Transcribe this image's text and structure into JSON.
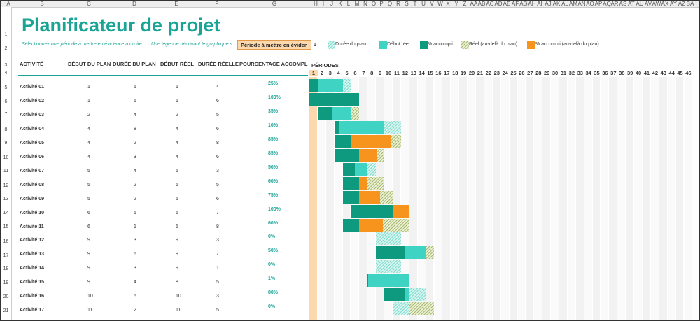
{
  "title": "Planificateur de projet",
  "subtitle_left": "Sélectionnez une période à mettre en évidence à droite",
  "subtitle_mid": "Une légende décrivant le graphique s",
  "period_highlight": {
    "label": "Période à mettre en éviden",
    "value": "1"
  },
  "legend": [
    {
      "label": "Durée du plan",
      "type": "hatch-plan"
    },
    {
      "label": "Début réel",
      "type": "solid-real"
    },
    {
      "label": "% accompli",
      "type": "solid-pct"
    },
    {
      "label": "Réel (au-delà du plan)",
      "type": "hatch-beyond"
    },
    {
      "label": "% accompli (au-delà du plan)",
      "type": "solid-orange"
    }
  ],
  "headers": {
    "activity": "ACTIVITÉ",
    "plan_start": "DÉBUT DU PLAN",
    "plan_duration": "DURÉE DU PLAN",
    "actual_start": "DÉBUT RÉEL",
    "actual_duration": "DURÉE RÉELLE",
    "percent": "POURCENTAGE ACCOMPLI",
    "periods": "PÉRIODES"
  },
  "columns": [
    "A",
    "B",
    "C",
    "D",
    "E",
    "F",
    "G",
    "H",
    "I",
    "J",
    "K",
    "L",
    "M",
    "N",
    "O",
    "P",
    "Q",
    "R",
    "S",
    "T",
    "U",
    "V",
    "W",
    "X",
    "Y",
    "Z",
    "AA",
    "AB",
    "AC",
    "AD",
    "AE",
    "AF",
    "AG",
    "AH",
    "AI",
    "AJ",
    "AK",
    "AL",
    "AM",
    "AN",
    "AO",
    "AP",
    "AQ",
    "AR",
    "AS",
    "AT",
    "AU",
    "AV",
    "AW",
    "AX",
    "AY",
    "AZ",
    "BA"
  ],
  "row_numbers": [
    "1",
    "2",
    "3",
    "4",
    "5",
    "6",
    "7",
    "8",
    "9",
    "10",
    "11",
    "12",
    "13",
    "14",
    "15",
    "16",
    "17",
    "18",
    "19",
    "20",
    "21"
  ],
  "periods": [
    "1",
    "2",
    "3",
    "4",
    "5",
    "6",
    "7",
    "8",
    "9",
    "10",
    "11",
    "12",
    "13",
    "14",
    "15",
    "16",
    "17",
    "18",
    "19",
    "20",
    "21",
    "22",
    "23",
    "24",
    "25",
    "26",
    "27",
    "28",
    "29",
    "30",
    "31",
    "32",
    "33",
    "34",
    "35",
    "36",
    "37",
    "38",
    "39",
    "40",
    "41",
    "42",
    "43",
    "44",
    "45",
    "46"
  ],
  "activities": [
    {
      "name": "Activité 01",
      "plan_start": 1,
      "plan_dur": 5,
      "act_start": 1,
      "act_dur": 4,
      "pct": "25%",
      "pct_val": 0.25
    },
    {
      "name": "Activité 02",
      "plan_start": 1,
      "plan_dur": 6,
      "act_start": 1,
      "act_dur": 6,
      "pct": "100%",
      "pct_val": 1.0
    },
    {
      "name": "Activité 03",
      "plan_start": 2,
      "plan_dur": 4,
      "act_start": 2,
      "act_dur": 5,
      "pct": "35%",
      "pct_val": 0.35
    },
    {
      "name": "Activité 04",
      "plan_start": 4,
      "plan_dur": 8,
      "act_start": 4,
      "act_dur": 6,
      "pct": "10%",
      "pct_val": 0.1
    },
    {
      "name": "Activité 05",
      "plan_start": 4,
      "plan_dur": 2,
      "act_start": 4,
      "act_dur": 8,
      "pct": "85%",
      "pct_val": 0.85
    },
    {
      "name": "Activité 06",
      "plan_start": 4,
      "plan_dur": 3,
      "act_start": 4,
      "act_dur": 6,
      "pct": "85%",
      "pct_val": 0.85
    },
    {
      "name": "Activité 07",
      "plan_start": 5,
      "plan_dur": 4,
      "act_start": 5,
      "act_dur": 3,
      "pct": "50%",
      "pct_val": 0.5
    },
    {
      "name": "Activité 08",
      "plan_start": 5,
      "plan_dur": 2,
      "act_start": 5,
      "act_dur": 5,
      "pct": "60%",
      "pct_val": 0.6
    },
    {
      "name": "Activité 09",
      "plan_start": 5,
      "plan_dur": 2,
      "act_start": 5,
      "act_dur": 6,
      "pct": "75%",
      "pct_val": 0.75
    },
    {
      "name": "Activité 10",
      "plan_start": 6,
      "plan_dur": 5,
      "act_start": 6,
      "act_dur": 7,
      "pct": "100%",
      "pct_val": 1.0
    },
    {
      "name": "Activité 11",
      "plan_start": 6,
      "plan_dur": 1,
      "act_start": 5,
      "act_dur": 8,
      "pct": "60%",
      "pct_val": 0.6
    },
    {
      "name": "Activité 12",
      "plan_start": 9,
      "plan_dur": 3,
      "act_start": 9,
      "act_dur": 3,
      "pct": "0%",
      "pct_val": 0.0
    },
    {
      "name": "Activité 13",
      "plan_start": 9,
      "plan_dur": 6,
      "act_start": 9,
      "act_dur": 7,
      "pct": "50%",
      "pct_val": 0.5
    },
    {
      "name": "Activité 14",
      "plan_start": 9,
      "plan_dur": 3,
      "act_start": 9,
      "act_dur": 1,
      "pct": "0%",
      "pct_val": 0.0
    },
    {
      "name": "Activité 15",
      "plan_start": 9,
      "plan_dur": 4,
      "act_start": 8,
      "act_dur": 5,
      "pct": "1%",
      "pct_val": 0.01
    },
    {
      "name": "Activité 16",
      "plan_start": 10,
      "plan_dur": 5,
      "act_start": 10,
      "act_dur": 3,
      "pct": "80%",
      "pct_val": 0.8
    },
    {
      "name": "Activité 17",
      "plan_start": 11,
      "plan_dur": 2,
      "act_start": 11,
      "act_dur": 5,
      "pct": "0%",
      "pct_val": 0.0
    }
  ],
  "colors": {
    "accent": "#1aa495",
    "highlight": "#fbd8ad",
    "orange": "#f7941d"
  }
}
